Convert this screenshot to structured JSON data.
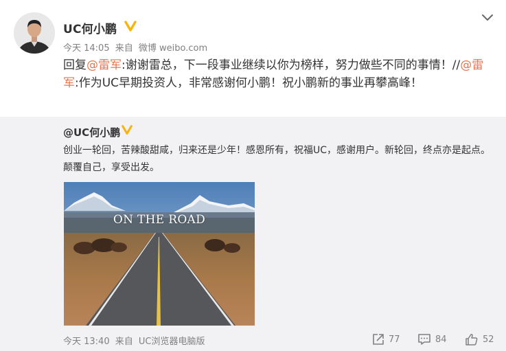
{
  "post": {
    "author": "UC何小鹏",
    "time": "今天 14:05",
    "source_prefix": "来自",
    "source": "微博 weibo.com",
    "reply_prefix": "回复",
    "mention_1": "@雷军",
    "text_1": ":谢谢雷总，下一段事业继续以你为榜样，努力做些不同的事情！//",
    "mention_2": "@雷军",
    "text_2": ":作为UC早期投资人，非常感谢何小鹏！祝小鹏新的事业再攀高峰！"
  },
  "original": {
    "author": "@UC何小鹏",
    "text": "创业一轮回，苦辣酸甜咸，归来还是少年！感恩所有，祝福UC，感谢用户。新轮回，终点亦是起点。颠覆自己，享受出发。",
    "image_caption": "ON THE ROAD",
    "time": "今天 13:40",
    "source_prefix": "来自",
    "source": "UC浏览器电脑版"
  },
  "actions": {
    "repost_count": "77",
    "comment_count": "84",
    "like_count": "52"
  },
  "icons": {
    "verified": "verified-badge-icon",
    "collapse": "chevron-down-icon",
    "repost": "repost-icon",
    "comment": "comment-icon",
    "like": "thumbs-up-icon"
  },
  "colors": {
    "mention": "#eb7350",
    "verified": "#f8b40b",
    "meta_text": "#808080",
    "repost_background": "#f2f2f5"
  }
}
